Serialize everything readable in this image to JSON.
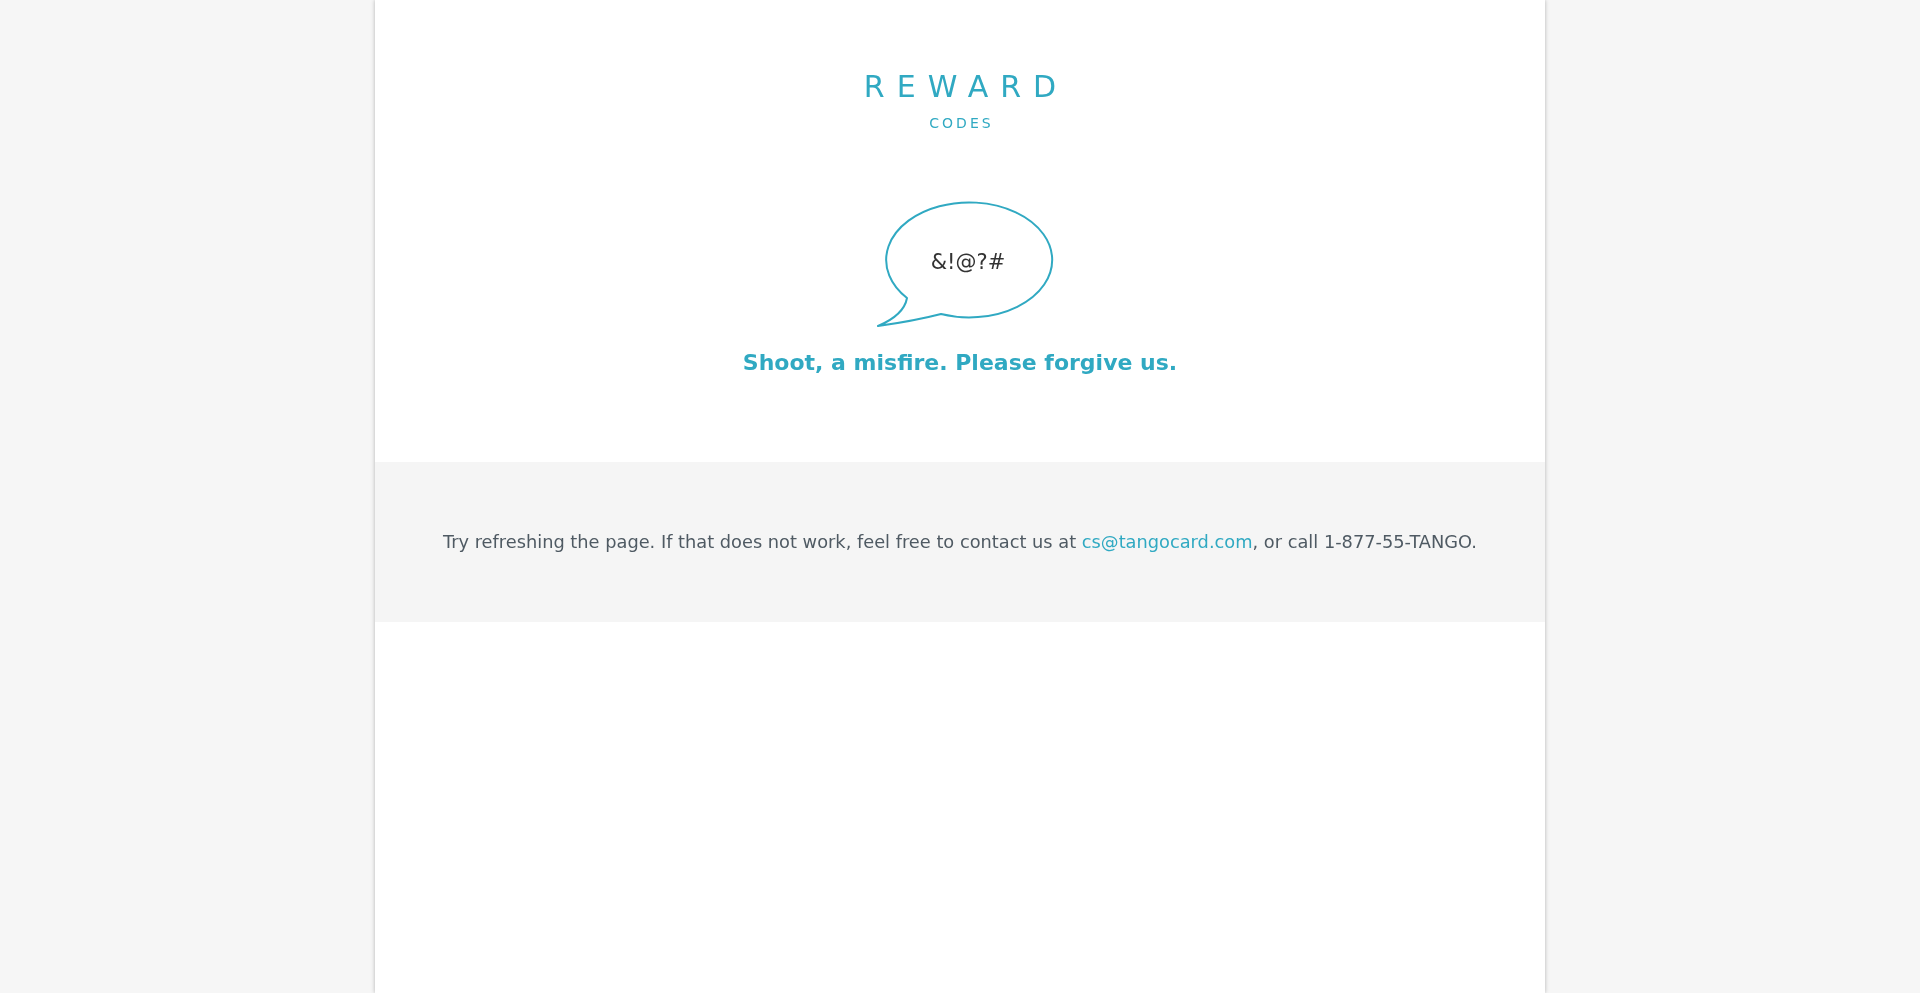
{
  "logo": {
    "wordmark": "REWARD",
    "subtitle": "CODES"
  },
  "error": {
    "bubble_text": "&!@?#",
    "heading": "Shoot, a misfire. Please forgive us."
  },
  "help": {
    "text_before": "Try refreshing the page. If that does not work, feel free to contact us at ",
    "link": "cs@tangocard.com",
    "text_after": ", or call 1-877-55-TANGO."
  }
}
